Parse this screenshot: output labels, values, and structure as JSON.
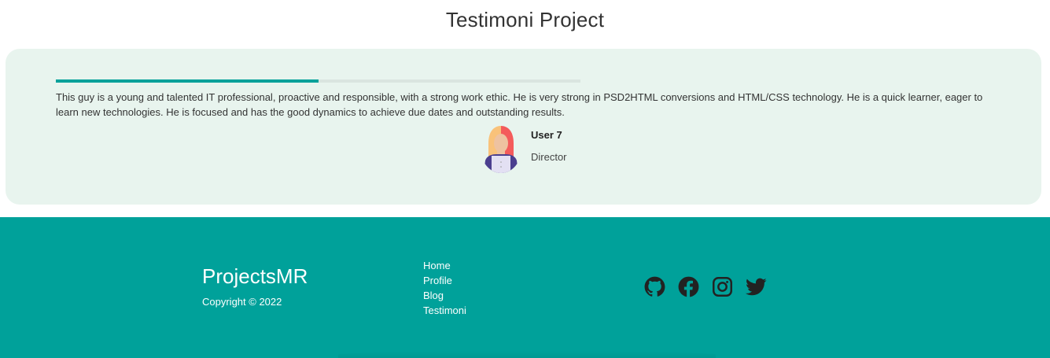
{
  "header": {
    "title": "Testimoni Project"
  },
  "testimonial": {
    "progress": 0.5,
    "progress_color": "#00a19a",
    "card_background": "#e8f4ee",
    "quote": "This guy is a young and talented IT professional, proactive and responsible, with a strong work ethic. He is very strong in PSD2HTML conversions and HTML/CSS technology. He is a quick learner, eager to learn new technologies. He is focused and has the good dynamics to achieve due dates and outstanding results.",
    "author": {
      "name": "User 7",
      "role": "Director",
      "avatar_icon": "female-user-avatar-icon"
    }
  },
  "footer": {
    "background": "#00a19a",
    "brand": "ProjectsMR",
    "copyright": "Copyright © 2022",
    "nav": [
      {
        "label": "Home"
      },
      {
        "label": "Profile"
      },
      {
        "label": "Blog"
      },
      {
        "label": "Testimoni"
      }
    ],
    "social": [
      {
        "icon": "github-icon"
      },
      {
        "icon": "facebook-icon"
      },
      {
        "icon": "instagram-icon"
      },
      {
        "icon": "twitter-icon"
      }
    ]
  }
}
